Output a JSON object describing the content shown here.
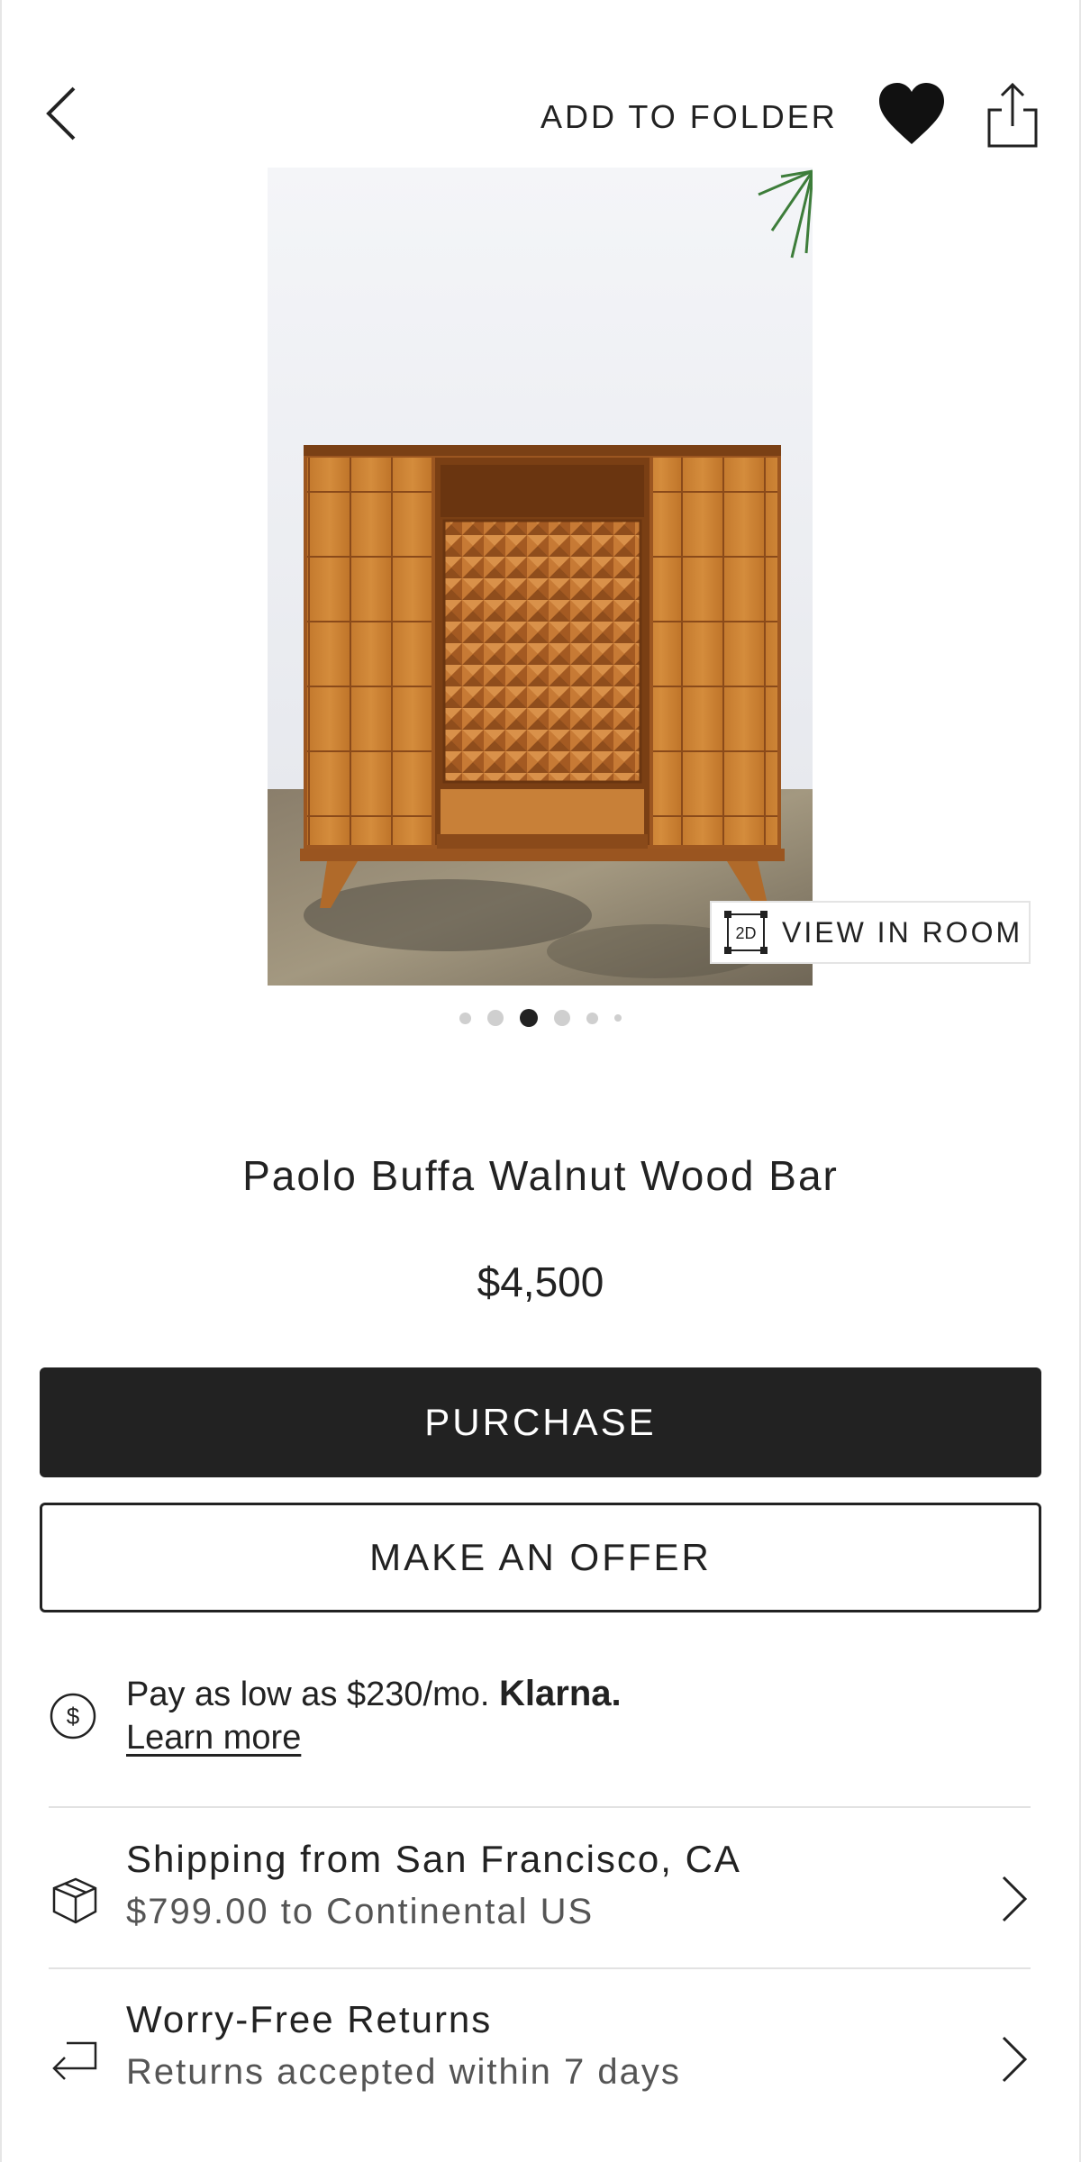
{
  "header": {
    "back_icon": "chevron-left-icon",
    "add_to_folder_label": "ADD TO FOLDER",
    "favorite_icon": "heart-icon",
    "share_icon": "share-icon"
  },
  "gallery": {
    "image_subject": "walnut wood bar cabinet",
    "view_in_room_badge": "2D",
    "view_in_room_label": "VIEW IN ROOM",
    "image_count": 6,
    "active_index": 2
  },
  "product": {
    "title": "Paolo Buffa Walnut Wood Bar",
    "price": "$4,500"
  },
  "actions": {
    "purchase_label": "PURCHASE",
    "offer_label": "MAKE AN OFFER"
  },
  "financing": {
    "icon": "dollar-circle-icon",
    "text": "Pay as low as $230/mo.",
    "brand": "Klarna.",
    "link_label": "Learn more"
  },
  "shipping": {
    "icon": "box-icon",
    "title": "Shipping from San Francisco, CA",
    "subtitle": "$799.00 to Continental US"
  },
  "returns": {
    "icon": "return-arrow-icon",
    "title": "Worry-Free Returns",
    "subtitle": "Returns accepted within 7 days"
  },
  "colors": {
    "primary_button_bg": "#222222",
    "text": "#222222",
    "secondary_text": "#555555",
    "divider": "#e2e2e2"
  }
}
